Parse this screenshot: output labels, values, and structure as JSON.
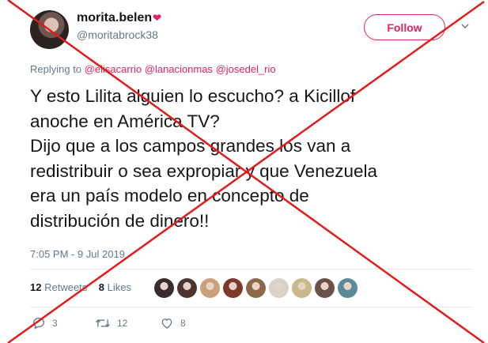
{
  "author": {
    "display_name": "morita.belen",
    "badge": "❤",
    "handle": "@moritabrock38"
  },
  "follow_label": "Follow",
  "replying": {
    "prefix": "Replying to",
    "mentions": [
      "@elisacarrio",
      "@lanacionmas",
      "@josedel_rio"
    ]
  },
  "tweet_lines": [
    "Y esto Lilita alguien lo escucho?  a Kicillof",
    "anoche en América TV?",
    "Dijo que a los campos grandes los van a",
    "redistribuir o sea expropiar y que Venezuela",
    "era un país modelo en concepto de",
    "distribución de dinero!!"
  ],
  "timestamp": "7:05 PM - 9 Jul 2019",
  "stats": {
    "retweets_count": "12",
    "retweets_label": "Retweets",
    "likes_count": "8",
    "likes_label": "Likes"
  },
  "actions": {
    "reply_count": "3",
    "retweet_count": "12",
    "like_count": "8"
  },
  "colors": {
    "accent": "#e0245e",
    "cross": "#e21b1b",
    "muted": "#657786"
  },
  "liker_avatar_colors": [
    "#3b2a2e",
    "#4a3530",
    "#c8a07a",
    "#7b3a2a",
    "#8a6a4a",
    "#d8d2c8",
    "#c9b88a",
    "#6b5048",
    "#5a8a9a"
  ]
}
